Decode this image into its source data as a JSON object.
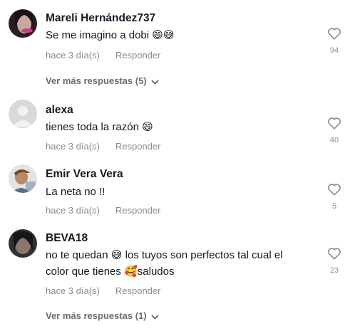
{
  "comments": [
    {
      "username": "Mareli Hernández737",
      "text_parts": [
        "Se me imagino a dobi",
        "😄😅"
      ],
      "time": "hace 3 día(s)",
      "reply_label": "Responder",
      "likes": "94",
      "more_replies": "Ver más respuestas (5)"
    },
    {
      "username": "alexa",
      "text_parts": [
        "tienes toda la razón",
        "😄"
      ],
      "time": "hace 3 día(s)",
      "reply_label": "Responder",
      "likes": "40"
    },
    {
      "username": "Emir Vera Vera",
      "text_parts": [
        "La neta no !!"
      ],
      "time": "hace 3 día(s)",
      "reply_label": "Responder",
      "likes": "5"
    },
    {
      "username": "BEVA18",
      "text_parts": [
        "no te quedan",
        "😅",
        "los tuyos son perfectos tal cual el color que tienes",
        "🥰",
        "saludos"
      ],
      "time": "hace 3 día(s)",
      "reply_label": "Responder",
      "likes": "23",
      "more_replies": "Ver más respuestas (1)"
    }
  ],
  "icons": {
    "like": "heart-outline-icon",
    "expand": "chevron-down-icon"
  },
  "colors": {
    "text": "#161823",
    "muted": "#8a8b91"
  }
}
